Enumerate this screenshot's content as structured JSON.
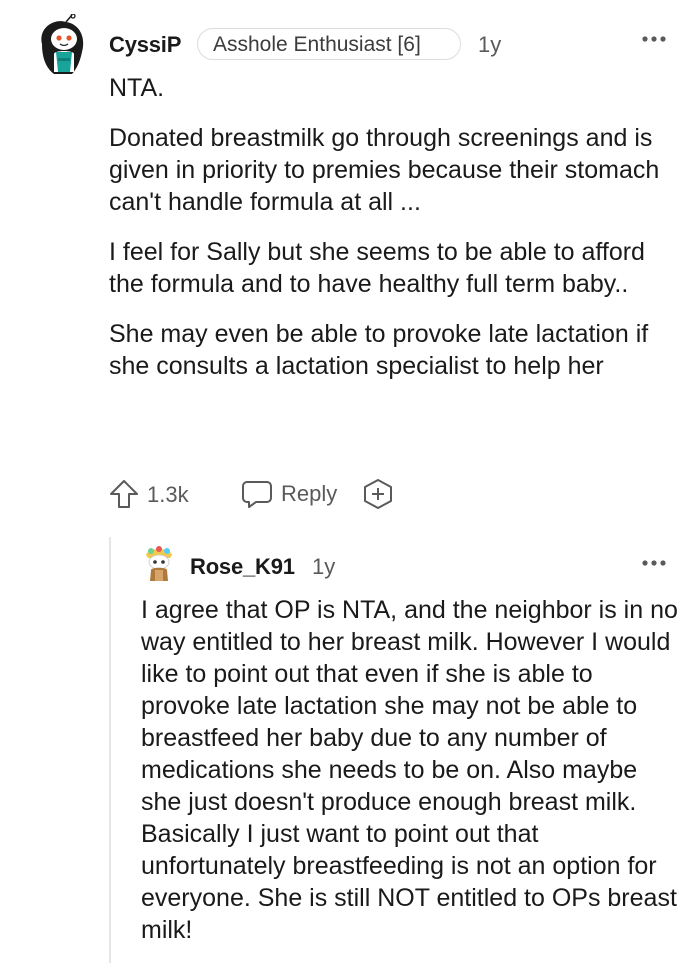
{
  "main_comment": {
    "author": "CyssiP",
    "flair": "Asshole Enthusiast [6]",
    "time": "1y",
    "paragraphs": [
      "NTA.",
      "Donated breastmilk go through screenings and is given in priority to premies because their stomach can't handle formula at all ...",
      "I feel for Sally but she seems to be able to afford the formula and to have healthy full term baby..",
      "She may even be able to provoke late lactation if she consults a lactation specialist to help her"
    ],
    "score": "1.3k",
    "reply_label": "Reply",
    "icons": {
      "avatar": "user-avatar",
      "upvote": "upvote-arrow-icon",
      "reply": "speech-bubble-icon",
      "award": "award-plus-icon",
      "more": "more-options-icon"
    }
  },
  "reply_comment": {
    "author": "Rose_K91",
    "time": "1y",
    "paragraphs": [
      "I agree that OP is NTA, and the neighbor is in no way entitled to her breast milk. However I would like to point out that even if she is able to provoke late lactation she may not be able to breastfeed her baby due to any number of medications she needs to be on. Also maybe she just doesn't produce enough breast milk. Basically I just want to point out that unfortunately breastfeeding is not an option for everyone. She is still NOT entitled to OPs breast milk!"
    ],
    "icons": {
      "avatar": "user-avatar",
      "more": "more-options-icon"
    }
  },
  "colors": {
    "text": "#1a1a1b",
    "muted": "#5a5a5a",
    "thread_line": "#e5e6e8",
    "flair_border": "#dadcdf"
  }
}
